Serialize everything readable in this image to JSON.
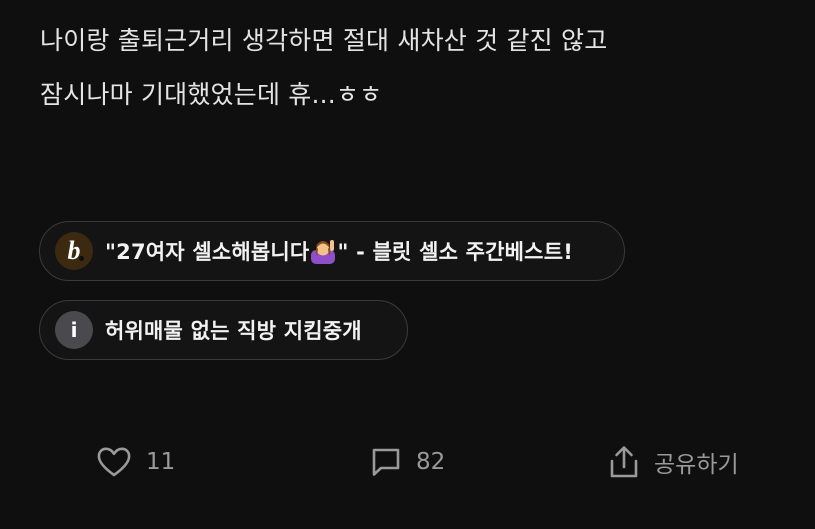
{
  "post": {
    "lines": [
      "나이랑 출퇴근거리 생각하면 절대 새차산 것 같진 않고",
      "잠시나마 기대했었는데 휴...ㅎㅎ"
    ]
  },
  "links": [
    {
      "icon": "b-logo-icon",
      "text_before": "\"27여자 셀소해봅니다",
      "emoji": "raising-hand-emoji",
      "text_after": "\" - 블릿 셀소 주간베스트!"
    },
    {
      "icon": "info-icon",
      "icon_glyph": "i",
      "text": "허위매물 없는 직방 지킴중개"
    }
  ],
  "actions": {
    "like": {
      "icon": "heart-icon",
      "count": "11"
    },
    "comment": {
      "icon": "comment-icon",
      "count": "82"
    },
    "share": {
      "icon": "share-icon",
      "label": "공유하기"
    }
  },
  "colors": {
    "background": "#0f0f0f",
    "text": "#e4e4e4",
    "muted": "#9a9a9a",
    "chip_border": "#3a3a3a"
  }
}
